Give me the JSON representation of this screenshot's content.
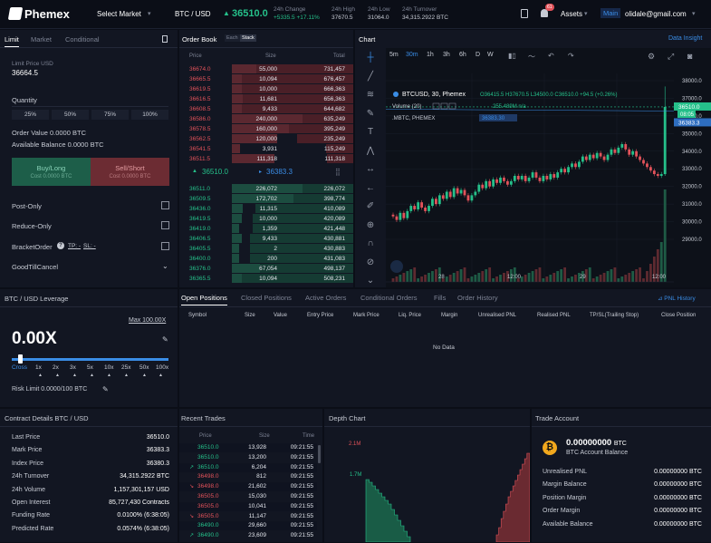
{
  "top": {
    "logo": "Phemex",
    "select_market": "Select Market",
    "pair": "BTC / USD",
    "price": "36510.0",
    "change_label": "24h Change",
    "change_val": "+5335.5 +17.11%",
    "high_label": "24h High",
    "high_val": "37670.5",
    "low_label": "24h Low",
    "low_val": "31064.0",
    "turnover_label": "24h Turnover",
    "turnover_val": "34,315.2922 BTC",
    "notif": "61",
    "assets": "Assets",
    "account": "Main",
    "email": "olidale@gmail.com"
  },
  "order_form": {
    "tabs": [
      "Limit",
      "Market",
      "Conditional"
    ],
    "limit_price_label": "Limit Price USD",
    "limit_price": "36664.5",
    "qty_label": "Quantity",
    "pcts": [
      "25%",
      "50%",
      "75%",
      "100%"
    ],
    "order_value": "Order Value 0.0000 BTC",
    "avail": "Available Balance 0.0000 BTC",
    "buy": "Buy/Long",
    "buy_cost": "Cost 0.0000 BTC",
    "sell": "Sell/Short",
    "sell_cost": "Cost 0.0000 BTC",
    "post_only": "Post-Only",
    "reduce_only": "Reduce-Only",
    "bracket": "BracketOrder",
    "tp": "TP: -",
    "sl": "SL: -",
    "gtc": "GoodTillCancel"
  },
  "orderbook": {
    "title": "Order Book",
    "each": "Each",
    "stack": "Stack",
    "h_price": "Price",
    "h_size": "Size",
    "h_total": "Total",
    "asks": [
      [
        "36674.0",
        "55,000",
        "731,457"
      ],
      [
        "36665.5",
        "10,094",
        "676,457"
      ],
      [
        "36619.5",
        "10,000",
        "666,363"
      ],
      [
        "36616.5",
        "11,681",
        "656,363"
      ],
      [
        "36608.5",
        "9,433",
        "644,682"
      ],
      [
        "36586.0",
        "240,000",
        "635,249"
      ],
      [
        "36578.5",
        "160,000",
        "395,249"
      ],
      [
        "36562.5",
        "120,000",
        "235,249"
      ],
      [
        "36541.5",
        "3,931",
        "115,249"
      ],
      [
        "36511.5",
        "111,318",
        "111,318"
      ]
    ],
    "last": "36510.0",
    "mark": "36383.3",
    "bids": [
      [
        "36511.0",
        "226,072",
        "226,072"
      ],
      [
        "36509.5",
        "172,702",
        "398,774"
      ],
      [
        "36436.0",
        "11,315",
        "410,089"
      ],
      [
        "36419.5",
        "10,000",
        "420,089"
      ],
      [
        "36419.0",
        "1,359",
        "421,448"
      ],
      [
        "36406.5",
        "9,433",
        "430,881"
      ],
      [
        "36405.5",
        "2",
        "430,883"
      ],
      [
        "36400.0",
        "200",
        "431,083"
      ],
      [
        "36376.0",
        "67,054",
        "498,137"
      ],
      [
        "36365.5",
        "10,094",
        "508,231"
      ]
    ]
  },
  "chart": {
    "title": "Chart",
    "insight": "Data Insight",
    "intervals": [
      "5m",
      "30m",
      "1h",
      "3h",
      "6h",
      "D",
      "W"
    ],
    "symbol": "BTCUSD, 30, Phemex",
    "ohlc": "O36415.5 H37670.5 L34500.0 C36510.0 +94.5 (+0.26%)",
    "volume": "Volume (20)",
    "vol_val": "255.489M n/a",
    "index_sym": ".MBTC, PHEMEX",
    "index_val": "36383.30",
    "y_ticks": [
      "38000.0",
      "37000.0",
      "36000.0",
      "35000.0",
      "34000.0",
      "33000.0",
      "32000.0",
      "31000.0",
      "30000.0",
      "29000.0"
    ],
    "price_tag": "36510.0",
    "countdown": "08:05",
    "mark_tag": "36383.3",
    "x_ticks": [
      "28",
      "12:00",
      "29",
      "12:00"
    ],
    "date_range": "Date Range",
    "time": "09:21:54 (UTC)",
    "pct": "%",
    "log": "log",
    "auto": "auto"
  },
  "leverage": {
    "title": "BTC / USD Leverage",
    "max": "Max 100.00X",
    "value": "0.00X",
    "marks": [
      "Cross",
      "1x",
      "2x",
      "3x",
      "5x",
      "10x",
      "25x",
      "50x",
      "100x"
    ],
    "risk": "Risk Limit 0.0000/100 BTC"
  },
  "positions": {
    "tabs": [
      "Open Positions",
      "Closed Positions",
      "Active Orders",
      "Conditional Orders",
      "Fills",
      "Order History"
    ],
    "pnl_history": "PNL History",
    "cols": [
      "Symbol",
      "Size",
      "Value",
      "Entry Price",
      "Mark Price",
      "Liq. Price",
      "Margin",
      "Unrealised PNL",
      "Realised PNL",
      "TP/SL(Trailing Stop)",
      "Close Position"
    ],
    "empty": "No Data"
  },
  "contract": {
    "title": "Contract Details BTC / USD",
    "rows": [
      [
        "Last Price",
        "36510.0"
      ],
      [
        "Mark Price",
        "36383.3"
      ],
      [
        "Index Price",
        "36380.3"
      ],
      [
        "24h Turnover",
        "34,315.2922 BTC"
      ],
      [
        "24h Volume",
        "1,157,301,157 USD"
      ],
      [
        "Open Interest",
        "85,727,430 Contracts"
      ],
      [
        "Funding Rate",
        "0.0100% (6:38:05)"
      ],
      [
        "Predicted Rate",
        "0.0574% (6:38:05)"
      ]
    ]
  },
  "trades": {
    "title": "Recent Trades",
    "h_price": "Price",
    "h_size": "Size",
    "h_time": "Time",
    "rows": [
      [
        "36510.0",
        "13,928",
        "09:21:55",
        "g",
        ""
      ],
      [
        "36510.0",
        "13,200",
        "09:21:55",
        "g",
        ""
      ],
      [
        "36510.0",
        "6,204",
        "09:21:55",
        "g",
        "up"
      ],
      [
        "36498.0",
        "812",
        "09:21:55",
        "r",
        ""
      ],
      [
        "36498.0",
        "21,602",
        "09:21:55",
        "r",
        "down"
      ],
      [
        "36505.0",
        "15,030",
        "09:21:55",
        "r",
        ""
      ],
      [
        "36505.0",
        "10,041",
        "09:21:55",
        "r",
        ""
      ],
      [
        "36505.0",
        "11,147",
        "09:21:55",
        "r",
        "down"
      ],
      [
        "36490.0",
        "29,660",
        "09:21:55",
        "g",
        ""
      ],
      [
        "36490.0",
        "23,609",
        "09:21:55",
        "g",
        "up"
      ]
    ]
  },
  "depth": {
    "title": "Depth Chart",
    "y1": "2.1M",
    "y2": "1.7M"
  },
  "account": {
    "title": "Trade Account",
    "balance": "0.00000000",
    "unit": "BTC",
    "balance_label": "BTC Account Balance",
    "rows": [
      [
        "Unrealised PNL",
        "0.00000000 BTC"
      ],
      [
        "Margin Balance",
        "0.00000000 BTC"
      ],
      [
        "Position Margin",
        "0.00000000 BTC"
      ],
      [
        "Order Margin",
        "0.00000000 BTC"
      ],
      [
        "Available Balance",
        "0.00000000 BTC"
      ]
    ]
  },
  "colors": {
    "green": "#25c08a",
    "red": "#e2525a",
    "accent": "#3a8de6",
    "bg": "#0b0e17",
    "panel": "#121622"
  }
}
